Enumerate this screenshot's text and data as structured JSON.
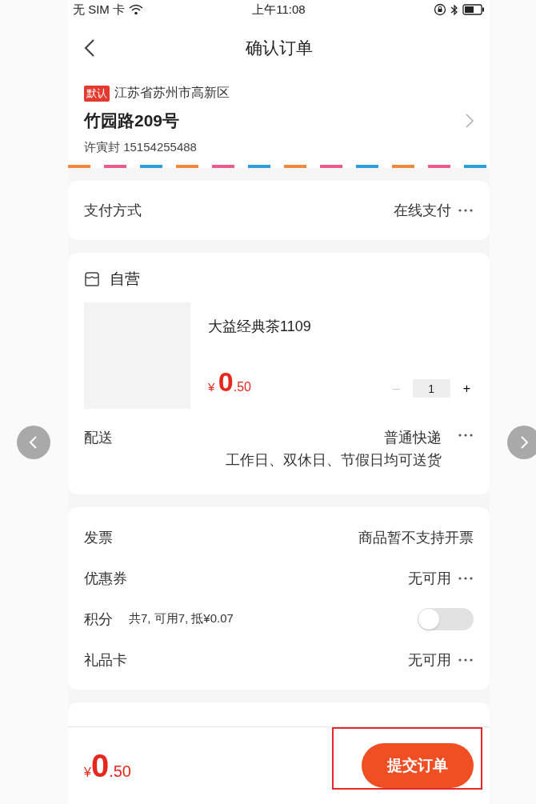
{
  "status_bar": {
    "carrier": "无 SIM 卡",
    "time": "上午11:08"
  },
  "nav": {
    "title": "确认订单"
  },
  "address": {
    "tag": "默认",
    "region": "江苏省苏州市高新区",
    "street": "竹园路209号",
    "contact": "许寅封 15154255488"
  },
  "payment": {
    "label": "支付方式",
    "value": "在线支付"
  },
  "shop": {
    "name": "自营",
    "product": {
      "name": "大益经典茶1109",
      "currency": "¥",
      "price_int": "0",
      "price_dec": ".50",
      "decrement": "–",
      "quantity": "1",
      "increment": "+"
    },
    "delivery": {
      "label": "配送",
      "value": "普通快递",
      "note": "工作日、双休日、节假日均可送货"
    }
  },
  "options": [
    {
      "kind": "text",
      "label": "发票",
      "value": "商品暂不支持开票"
    },
    {
      "kind": "more",
      "label": "优惠券",
      "value": "无可用"
    },
    {
      "kind": "toggle",
      "label": "积分",
      "detail": "共7, 可用7, 抵¥0.07",
      "on": false
    },
    {
      "kind": "more",
      "label": "礼品卡",
      "value": "无可用"
    }
  ],
  "footer": {
    "currency": "¥",
    "price_int": "0",
    "price_dec": ".50",
    "submit": "提交订单"
  }
}
